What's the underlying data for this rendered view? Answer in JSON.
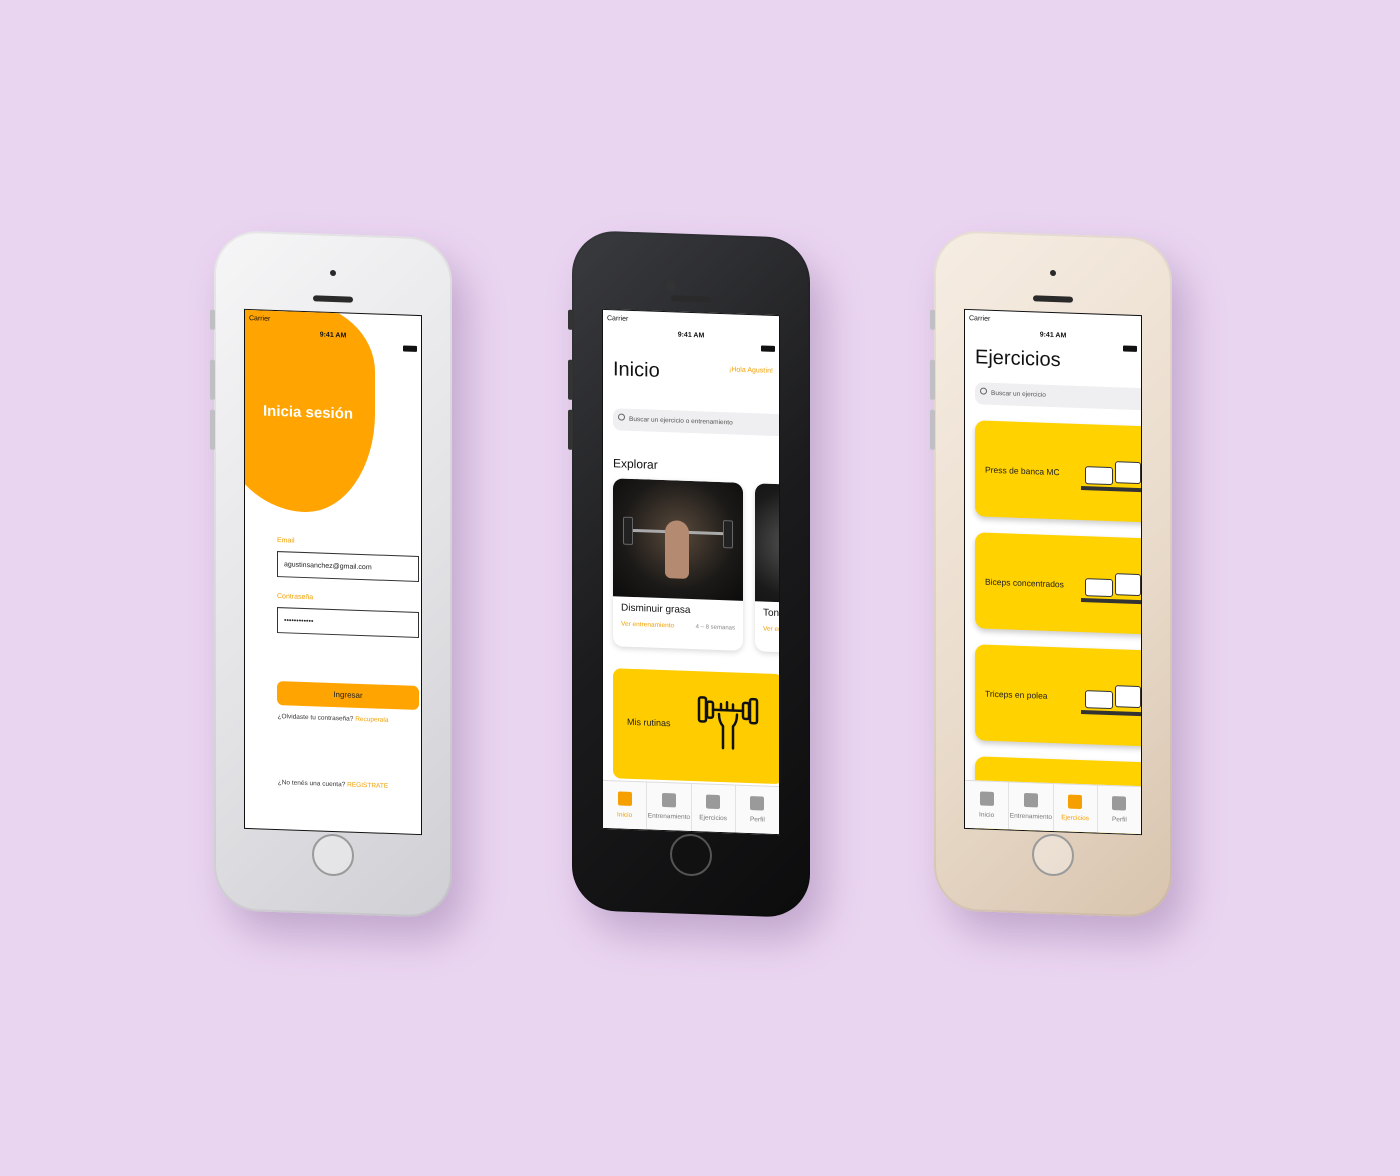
{
  "status": {
    "carrier": "Carrier",
    "time": "9:41 AM"
  },
  "login": {
    "title": "Inicia sesión",
    "email_label": "Email",
    "email_value": "agustinsanchez@gmail.com",
    "password_label": "Contraseña",
    "password_value": "••••••••••••",
    "submit_label": "Ingresar",
    "forgot_text": "¿Olvidaste tu contraseña?",
    "forgot_link": "Recuperala",
    "signup_text": "¿No tenés una cuenta?",
    "signup_link": "REGISTRATE"
  },
  "home": {
    "title": "Inicio",
    "greeting": "¡Hola Agustín!",
    "search_placeholder": "Buscar un ejercicio o entrenamiento",
    "section": "Explorar",
    "cards": [
      {
        "name": "Disminuir grasa",
        "link": "Ver entrenamiento",
        "meta": "4 – 8 semanas"
      },
      {
        "name": "Tonificar",
        "link": "Ver entrenamiento",
        "meta": ""
      }
    ],
    "routines_label": "Mis rutinas"
  },
  "exercises": {
    "title": "Ejercicios",
    "search_placeholder": "Buscar un ejercicio",
    "items": [
      {
        "name": "Press de banca MC"
      },
      {
        "name": "Biceps concentrados"
      },
      {
        "name": "Triceps en polea"
      }
    ]
  },
  "tabs": [
    {
      "label": "Inicio",
      "icon": "grid-icon"
    },
    {
      "label": "Entrenamiento",
      "icon": "calculator-icon"
    },
    {
      "label": "Ejercicios",
      "icon": "clipboard-icon"
    },
    {
      "label": "Perfil",
      "icon": "people-icon"
    }
  ],
  "colors": {
    "background": "#ead5f1",
    "orange": "#ffa400",
    "yellow": "#ffd200",
    "accent": "#f0a000"
  }
}
